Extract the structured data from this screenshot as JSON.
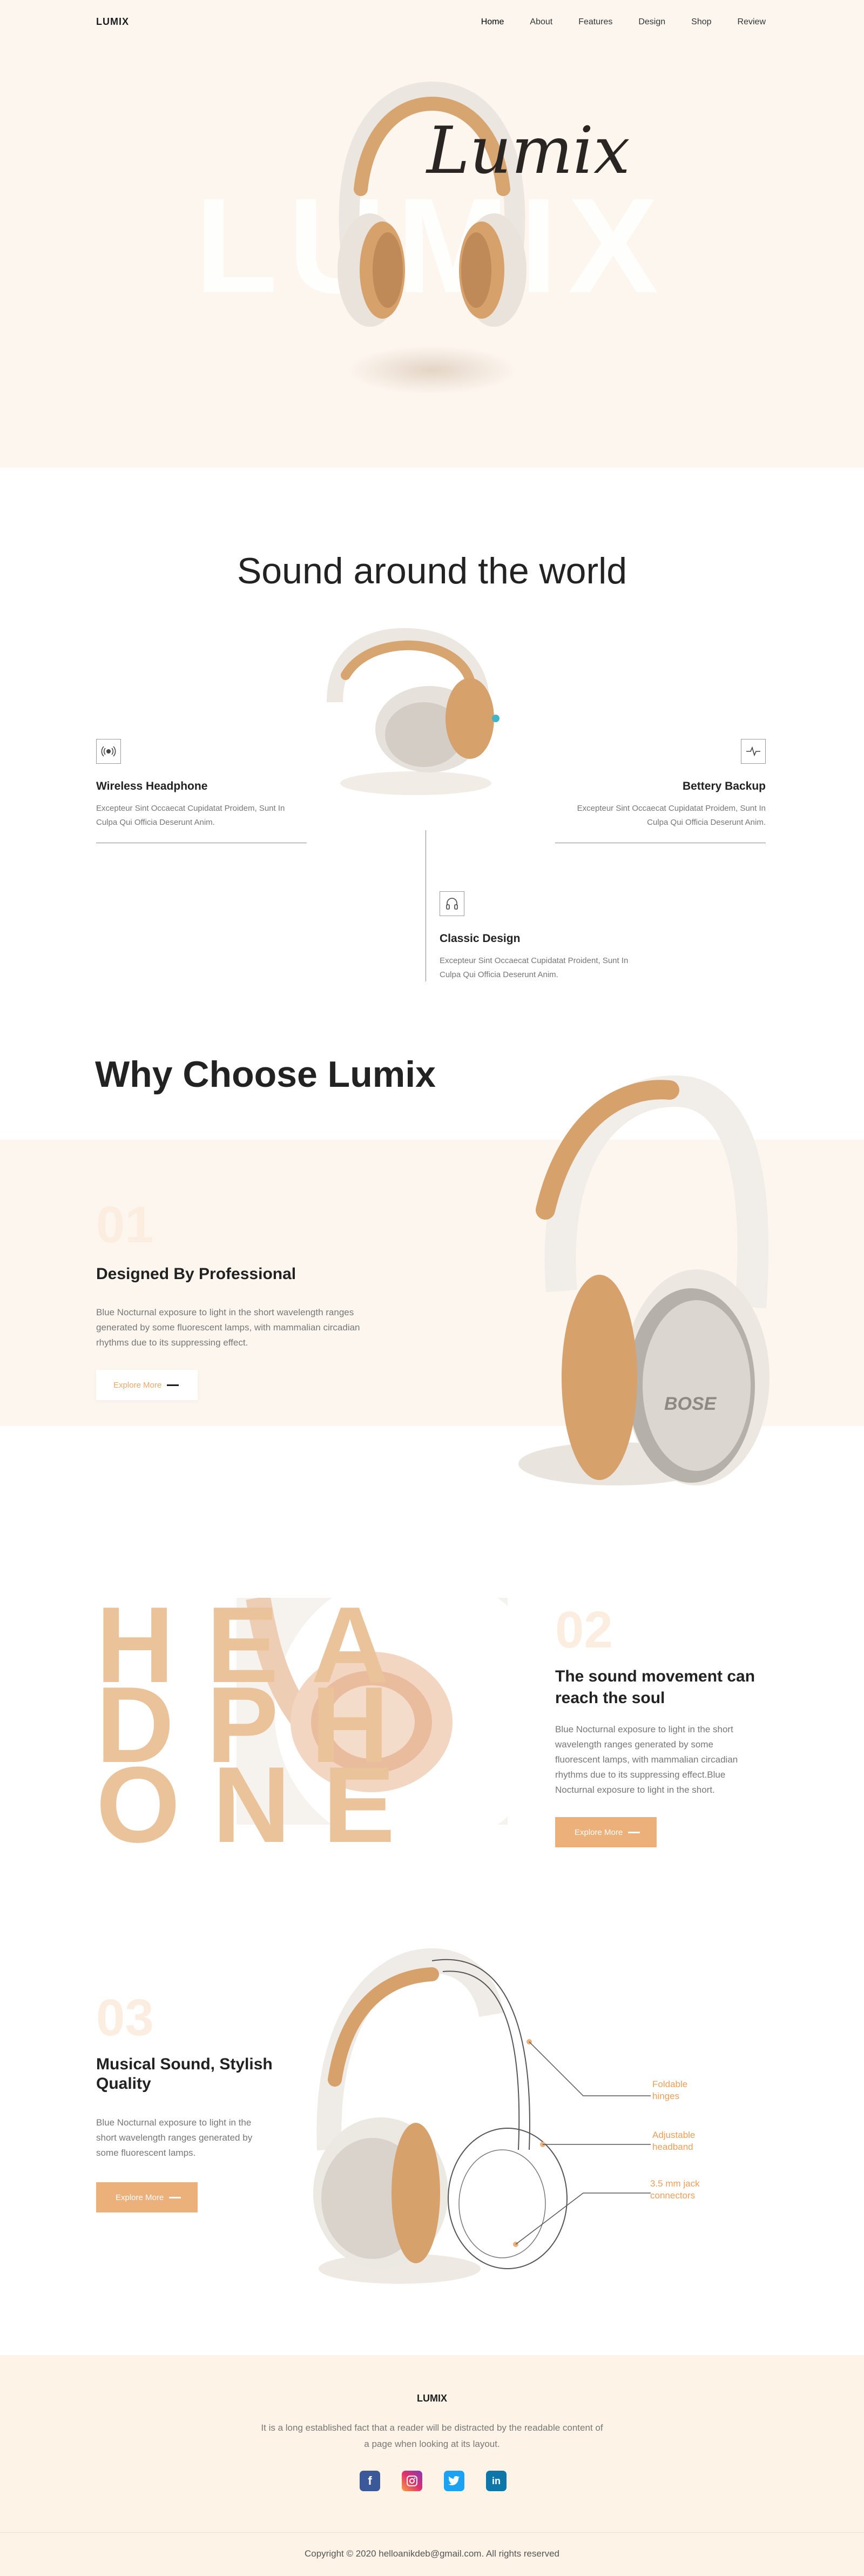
{
  "brand": "LUMIX",
  "nav": {
    "items": [
      "Home",
      "About",
      "Features",
      "Design",
      "Shop",
      "Review"
    ]
  },
  "hero": {
    "big_text": "LUMIX",
    "script_text": "Lumix"
  },
  "sound": {
    "title": "Sound around the world",
    "features": [
      {
        "icon": "wireless-icon",
        "title": "Wireless Headphone",
        "text": "Excepteur Sint Occaecat Cupidatat Proidem, Sunt In Culpa Qui Officia Deserunt Anim."
      },
      {
        "icon": "battery-pulse-icon",
        "title": "Bettery Backup",
        "text": "Excepteur Sint Occaecat Cupidatat Proidem, Sunt In Culpa Qui Officia Deserunt Anim."
      },
      {
        "icon": "headphone-icon",
        "title": "Classic Design",
        "text": "Excepteur Sint Occaecat Cupidatat Proident, Sunt In Culpa Qui Officia Deserunt Anim."
      }
    ]
  },
  "why": {
    "title": "Why Choose Lumix",
    "num": "01",
    "subtitle": "Designed By Professional",
    "text": "Blue Nocturnal exposure to light in the short wavelength ranges generated by some fluorescent lamps, with mammalian circadian rhythms due to its suppressing effect.",
    "button": "Explore More"
  },
  "section2": {
    "letters": [
      "HEA",
      "DPH",
      "ONE"
    ],
    "num": "02",
    "title": "The sound movement can reach the soul",
    "text": "Blue Nocturnal exposure to light in the short wavelength ranges generated by some fluorescent lamps, with mammalian circadian rhythms due to its suppressing effect.Blue Nocturnal exposure to light in the short.",
    "button": "Explore More"
  },
  "section3": {
    "num": "03",
    "title": "Musical Sound, Stylish Quality",
    "text": "Blue Nocturnal exposure to light in the short wavelength ranges generated by some fluorescent lamps.",
    "button": "Explore More",
    "annotations": [
      "Foldable hinges",
      "Adjustable headband",
      "3.5 mm jack connectors"
    ]
  },
  "footer": {
    "logo": "LUMIX",
    "text": "It is a long established fact that a reader will be distracted by the readable content of a page when looking at its layout.",
    "social": [
      "facebook-icon",
      "instagram-icon",
      "twitter-icon",
      "linkedin-icon"
    ],
    "copyright": "Copyright © 2020 helloanikdeb@gmail.com. All rights reserved"
  },
  "colors": {
    "cream": "#fdf6ef",
    "accent": "#ecb07a",
    "letters": "#eac39a",
    "annotation": "#ec9e5a"
  }
}
